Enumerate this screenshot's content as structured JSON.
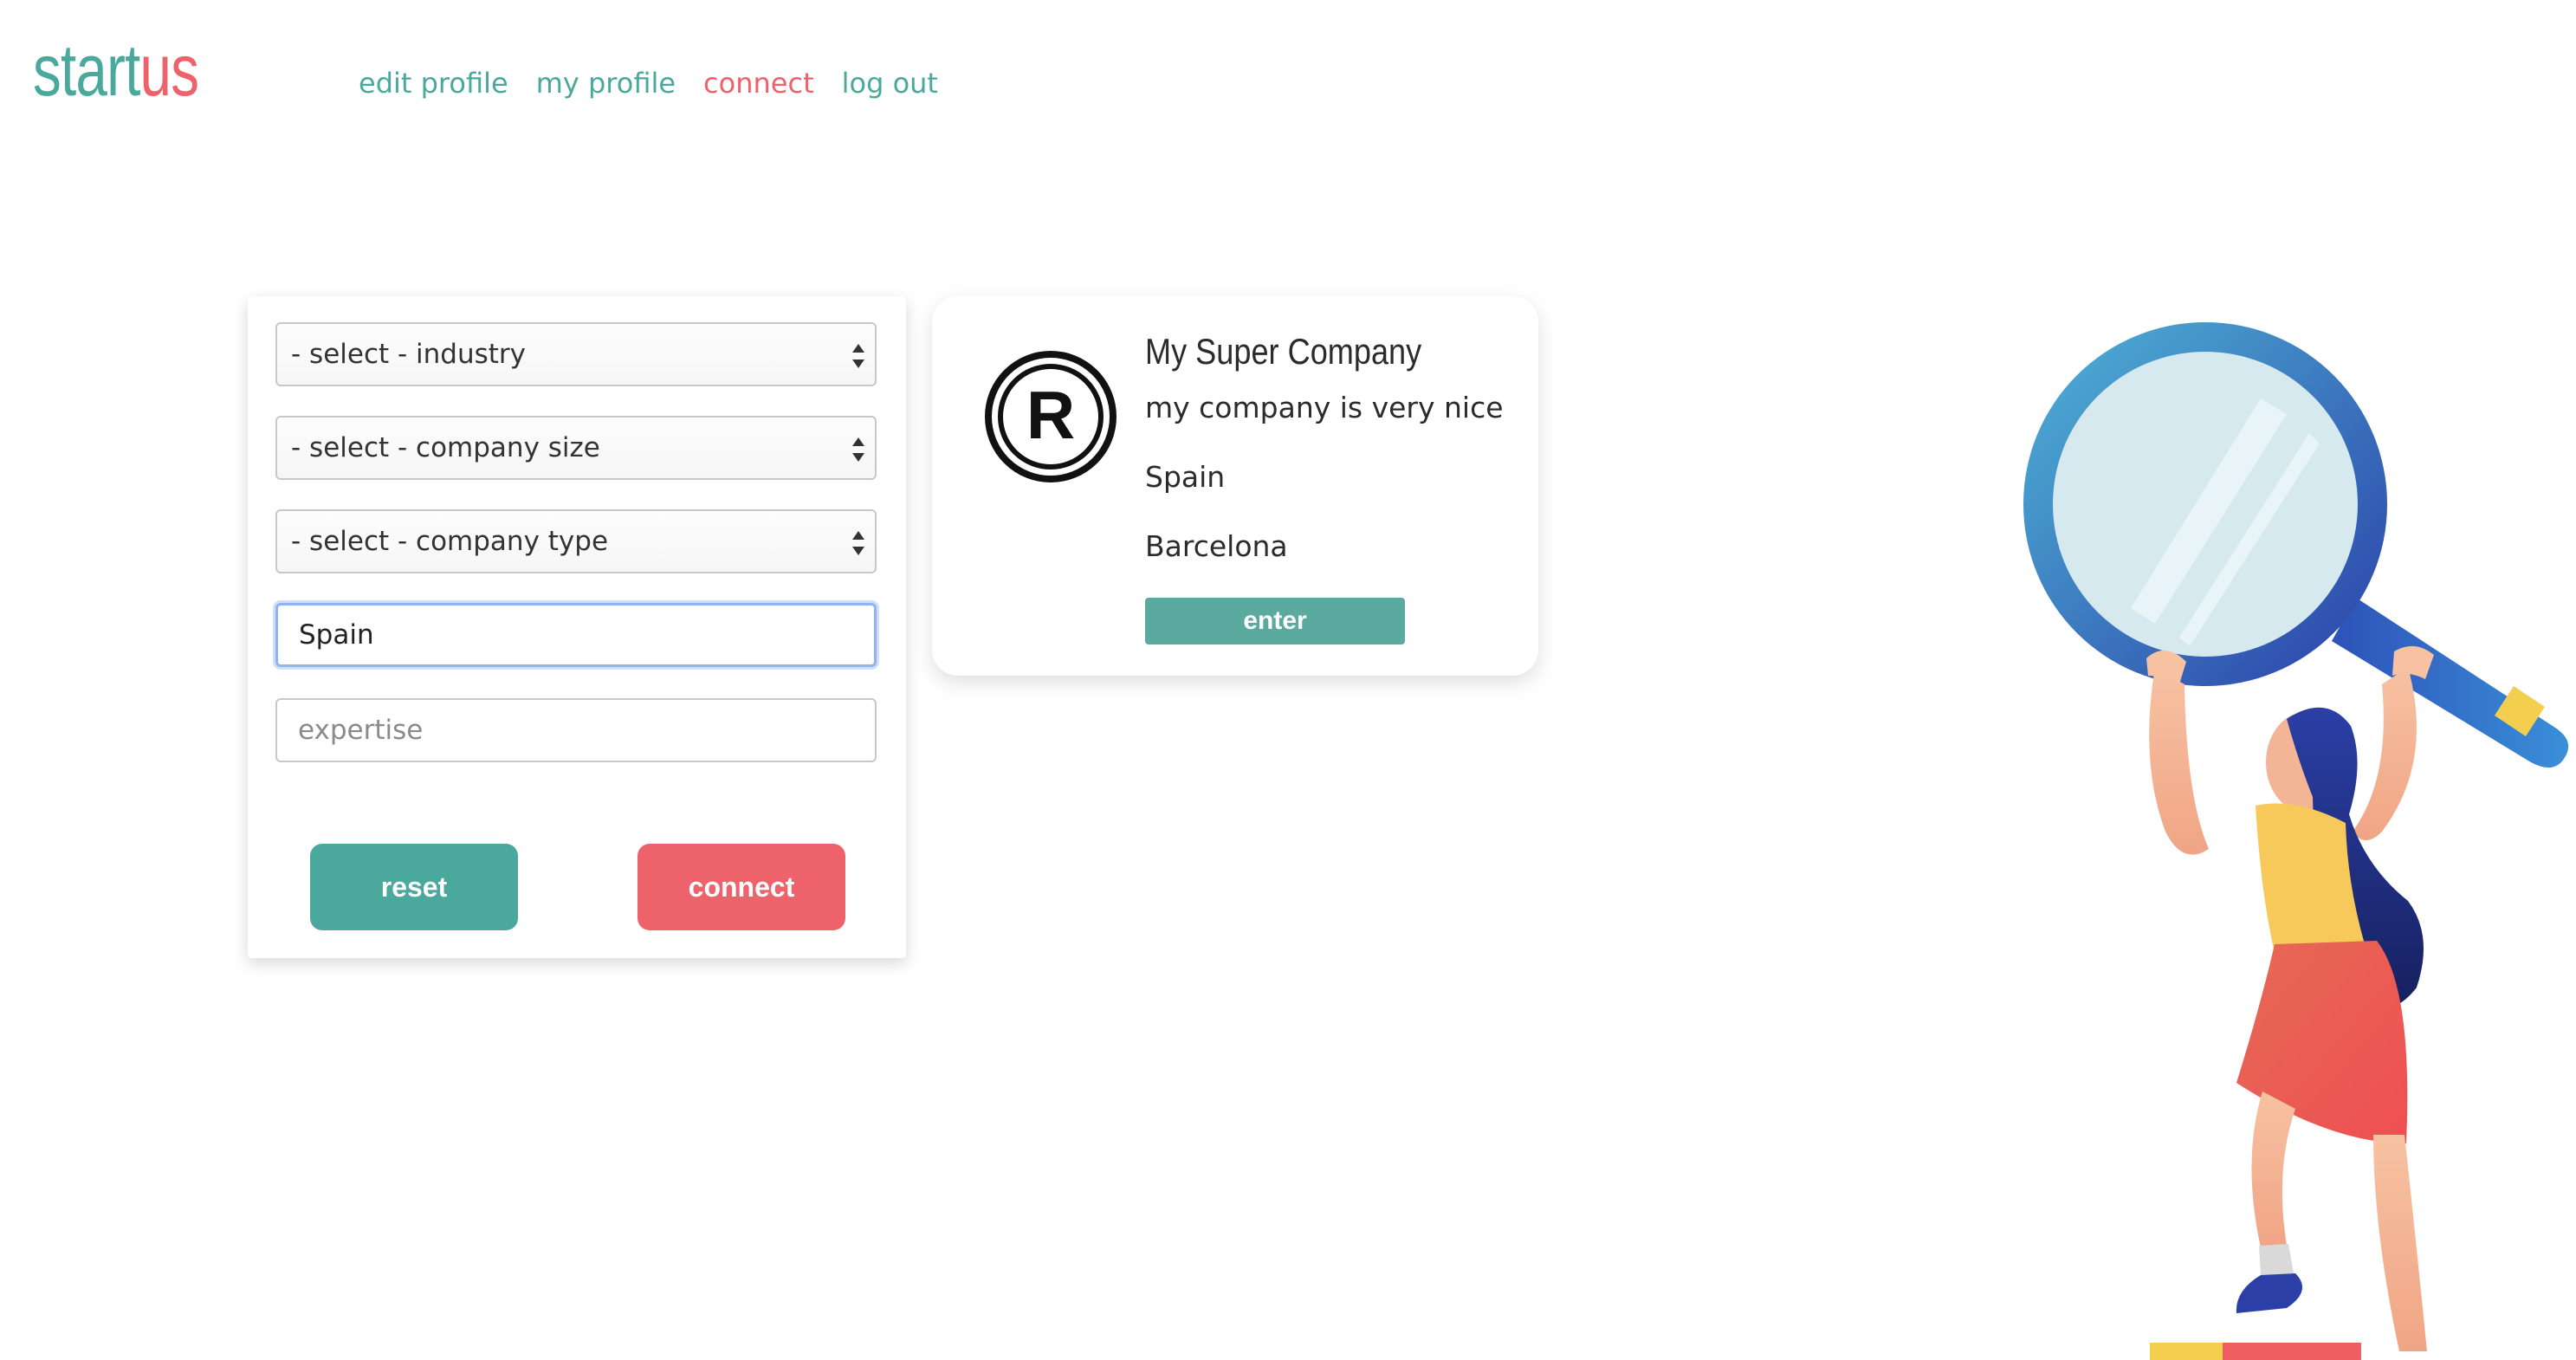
{
  "brand": {
    "part1": "start",
    "part2": "us"
  },
  "nav": [
    {
      "label": "edit profile"
    },
    {
      "label": "my profile"
    },
    {
      "label": "connect"
    },
    {
      "label": "log out"
    }
  ],
  "filters": {
    "industry": "- select - industry",
    "company_size": "- select - company size",
    "company_type": "- select - company type",
    "location_value": "Spain",
    "expertise_placeholder": "expertise"
  },
  "buttons": {
    "reset": "reset",
    "connect": "connect"
  },
  "company": {
    "name": "My Super Company",
    "description": "my company is very nice",
    "country": "Spain",
    "city": "Barcelona",
    "enter_label": "enter",
    "logo_letter": "R"
  },
  "colors": {
    "teal": "#4aa99c",
    "coral": "#ee636b"
  }
}
